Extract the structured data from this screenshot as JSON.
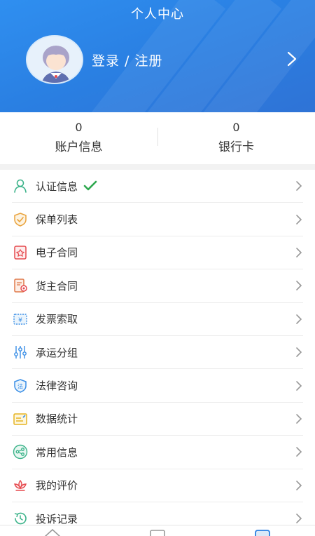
{
  "header": {
    "title": "个人中心",
    "login_label": "登录 / 注册"
  },
  "stats": [
    {
      "value": "0",
      "label": "账户信息"
    },
    {
      "value": "0",
      "label": "银行卡"
    }
  ],
  "menu": [
    {
      "label": "认证信息",
      "icon": "person-icon",
      "verified": true
    },
    {
      "label": "保单列表",
      "icon": "shield-check-icon"
    },
    {
      "label": "电子合同",
      "icon": "contract-icon"
    },
    {
      "label": "货主合同",
      "icon": "document-icon"
    },
    {
      "label": "发票索取",
      "icon": "invoice-icon"
    },
    {
      "label": "承运分组",
      "icon": "sliders-icon"
    },
    {
      "label": "法律咨询",
      "icon": "law-shield-icon"
    },
    {
      "label": "数据统计",
      "icon": "chart-card-icon"
    },
    {
      "label": "常用信息",
      "icon": "share-icon"
    },
    {
      "label": "我的评价",
      "icon": "lotus-icon"
    },
    {
      "label": "投诉记录",
      "icon": "history-icon"
    }
  ],
  "colors": {
    "header_blue": "#2a7fe2",
    "check_green": "#2fa84f",
    "icon_green": "#3cb38a",
    "icon_orange": "#e9a23b",
    "icon_red": "#e5484d",
    "icon_blue": "#3a8ee6",
    "icon_yellow": "#e6b422"
  }
}
